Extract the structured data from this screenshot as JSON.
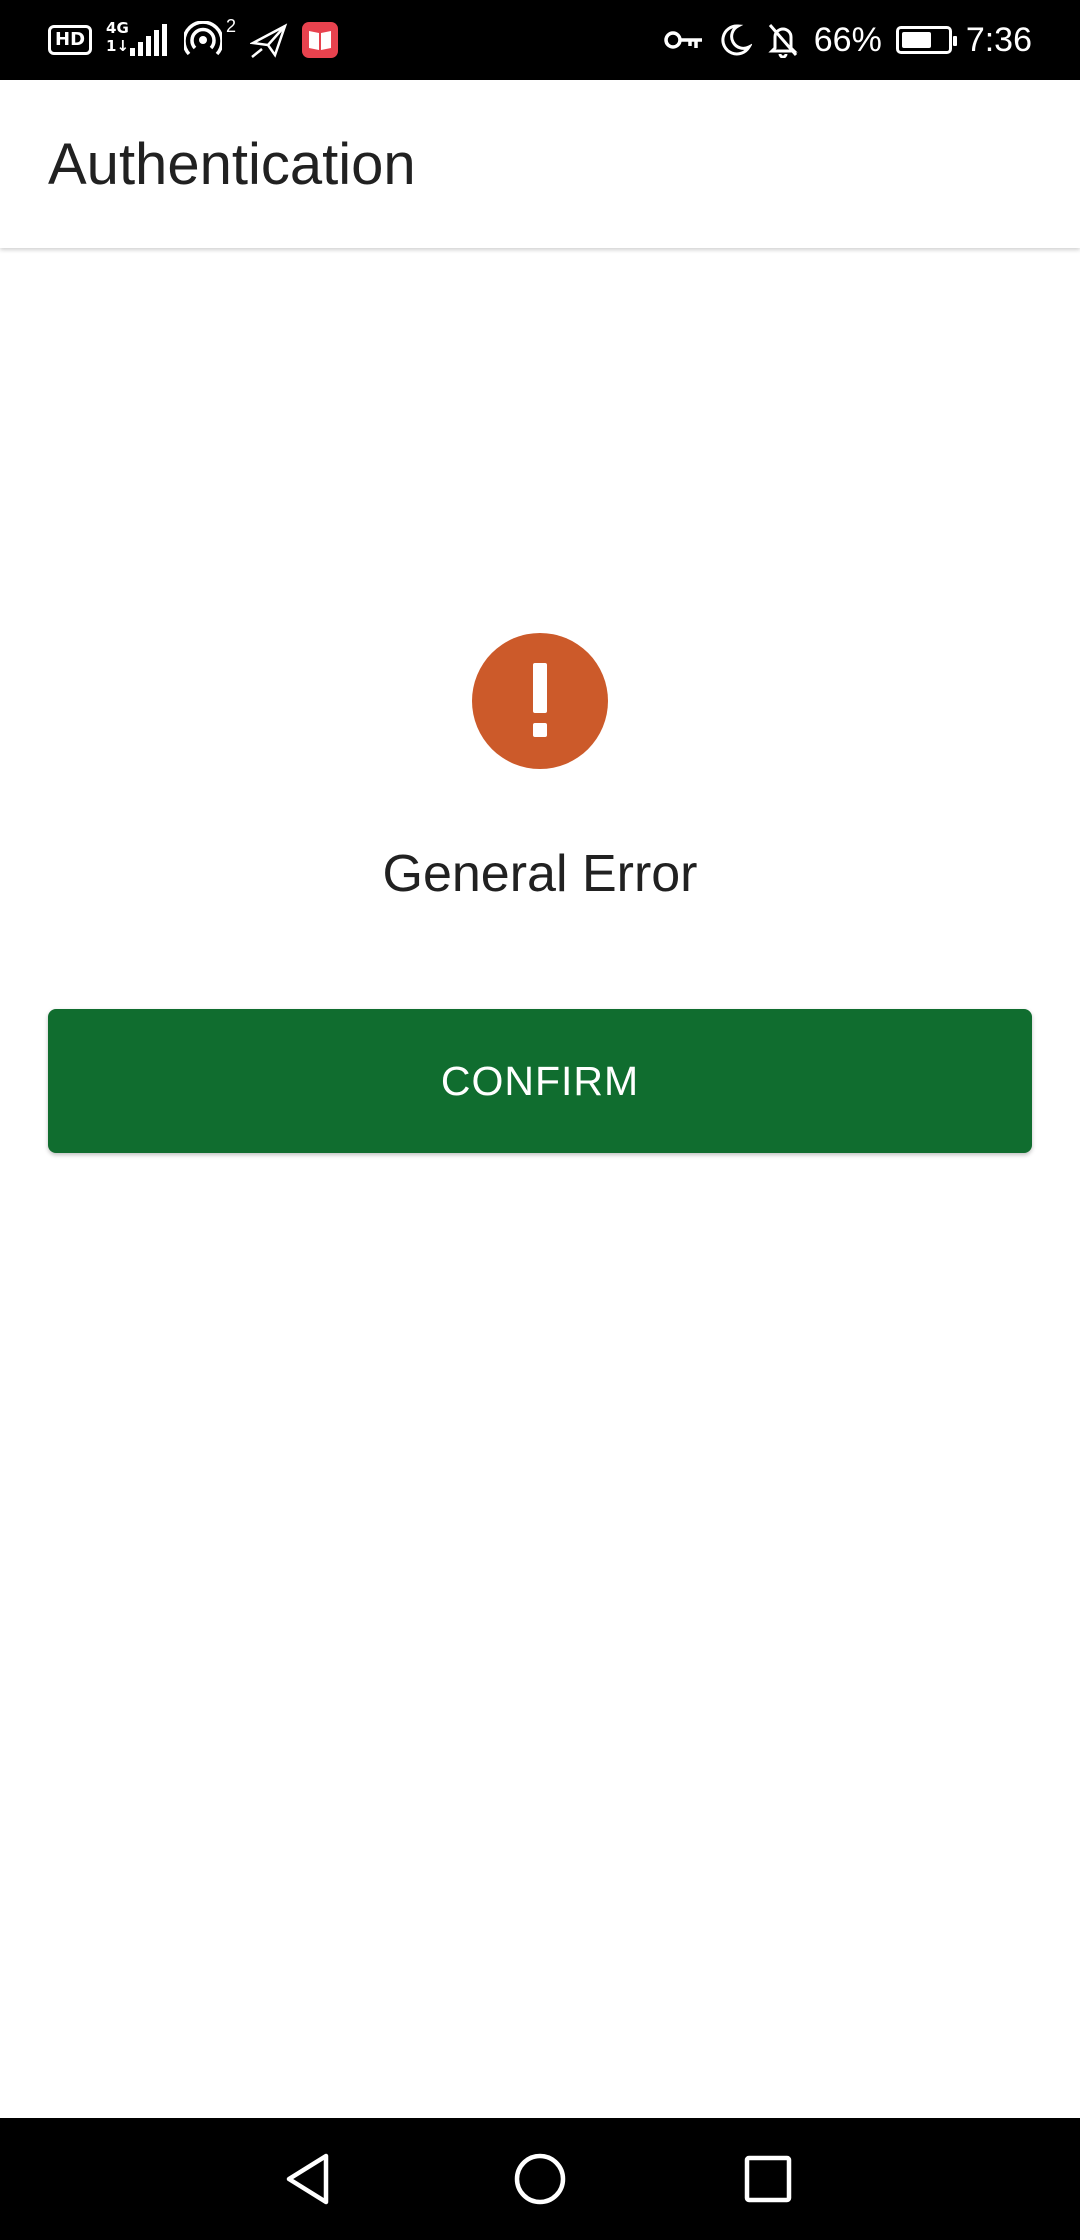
{
  "status_bar": {
    "hd_label": "HD",
    "network_type": "4G",
    "hotspot_count": "2",
    "battery_percent": "66%",
    "battery_level": 0.66,
    "time": "7:36",
    "icons": [
      "hd-icon",
      "signal-icon",
      "hotspot-icon",
      "airplane-icon",
      "book-app-icon",
      "key-icon",
      "moon-icon",
      "bell-off-icon",
      "battery-icon"
    ]
  },
  "app_bar": {
    "title": "Authentication"
  },
  "main": {
    "error_icon": "exclamation-icon",
    "error_message": "General Error",
    "confirm_label": "CONFIRM"
  },
  "nav_bar": {
    "icons": [
      "back-icon",
      "home-icon",
      "recents-icon"
    ]
  },
  "colors": {
    "status_bar_bg": "#000000",
    "error_accent": "#cc5a2a",
    "button_bg": "#106d2f",
    "title_text": "#212121"
  }
}
